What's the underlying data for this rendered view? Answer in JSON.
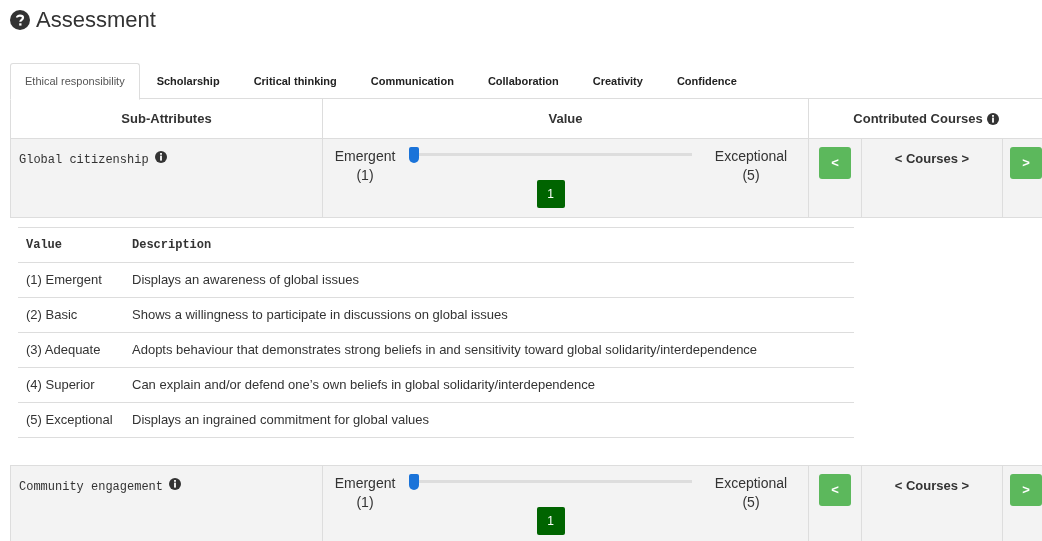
{
  "title": "Assessment",
  "tabs": [
    {
      "label": "Ethical responsibility",
      "selected": true
    },
    {
      "label": "Scholarship",
      "selected": false
    },
    {
      "label": "Critical thinking",
      "selected": false
    },
    {
      "label": "Communication",
      "selected": false
    },
    {
      "label": "Collaboration",
      "selected": false
    },
    {
      "label": "Creativity",
      "selected": false
    },
    {
      "label": "Confidence",
      "selected": false
    }
  ],
  "table": {
    "columns": [
      "Sub-Attributes",
      "Value",
      "Contributed Courses"
    ],
    "rows": [
      {
        "name": "Global citizenship",
        "min_label": "Emergent",
        "min_value": "(1)",
        "max_label": "Exceptional",
        "max_value": "(5)",
        "level": 0,
        "value": "1",
        "prev": "<",
        "courses": "< Courses >",
        "next": ">",
        "descriptions": {
          "columns": [
            "Value",
            "Description"
          ],
          "rows": [
            [
              "(1) Emergent",
              "Displays an awareness of global issues"
            ],
            [
              "(2) Basic",
              "Shows a willingness to participate in discussions on global issues"
            ],
            [
              "(3) Adequate",
              "Adopts behaviour that demonstrates strong beliefs in and sensitivity toward global solidarity/interdependence"
            ],
            [
              "(4) Superior",
              "Can explain and/or defend one’s own beliefs in global solidarity/interdependence"
            ],
            [
              "(5) Exceptional",
              "Displays an ingrained commitment for global values"
            ]
          ]
        }
      },
      {
        "name": "Community engagement",
        "min_label": "Emergent",
        "min_value": "(1)",
        "max_label": "Exceptional",
        "max_value": "(5)",
        "level": 0,
        "value": "1",
        "prev": "<",
        "courses": "< Courses >",
        "next": ">"
      }
    ]
  }
}
